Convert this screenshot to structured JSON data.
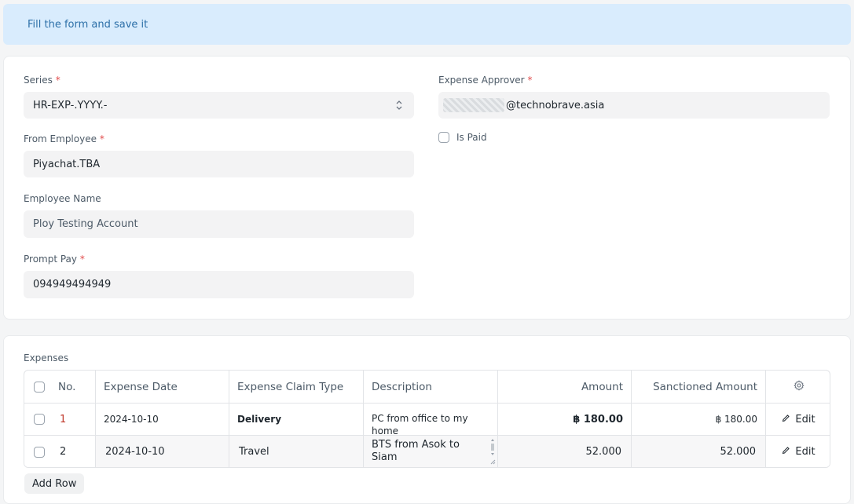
{
  "alert": {
    "message": "Fill the form and save it"
  },
  "form": {
    "series": {
      "label": "Series",
      "required": "*",
      "value": "HR-EXP-.YYYY.-"
    },
    "from_employee": {
      "label": "From Employee",
      "required": "*",
      "value": "Piyachat.TBA"
    },
    "employee_name": {
      "label": "Employee Name",
      "value": "Ploy Testing Account"
    },
    "prompt_pay": {
      "label": "Prompt Pay",
      "required": "*",
      "value": "094949494949"
    },
    "expense_approver": {
      "label": "Expense Approver",
      "required": "*",
      "value": "@technobrave.asia"
    },
    "is_paid": {
      "label": "Is Paid",
      "checked": false
    }
  },
  "expenses": {
    "label": "Expenses",
    "columns": {
      "no": "No.",
      "expense_date": "Expense Date",
      "claim_type": "Expense Claim Type",
      "description": "Description",
      "amount": "Amount",
      "sanctioned": "Sanctioned Amount"
    },
    "rows": [
      {
        "no": "1",
        "date": "2024-10-10",
        "type": "Delivery",
        "description": "PC from office to my home",
        "amount": "฿ 180.00",
        "sanctioned": "฿ 180.00",
        "edit": "Edit"
      },
      {
        "no": "2",
        "date": "2024-10-10",
        "type": "Travel",
        "description": "BTS from Asok to Siam",
        "amount": "52.000",
        "sanctioned": "52.000",
        "edit": "Edit"
      }
    ],
    "add_row": "Add Row"
  }
}
